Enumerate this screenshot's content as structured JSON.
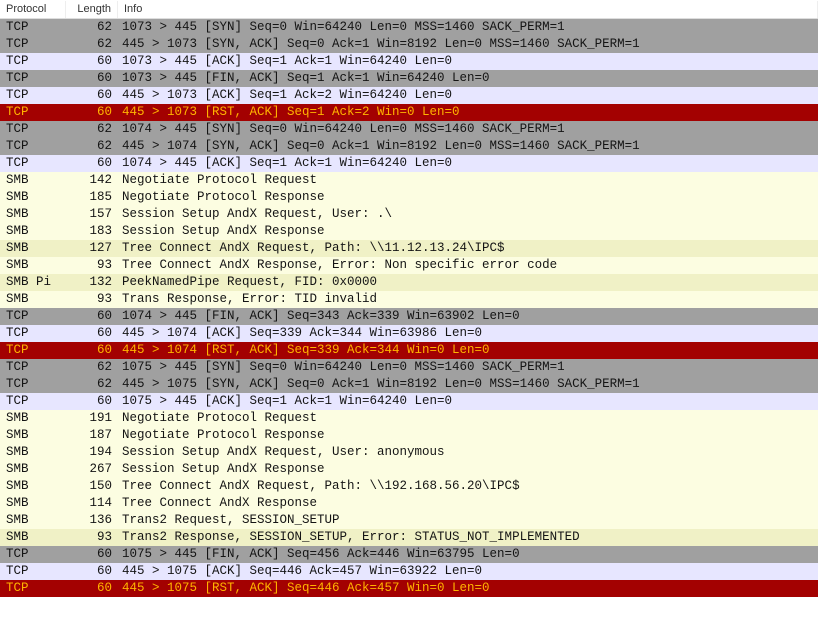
{
  "headers": {
    "protocol": "Protocol",
    "length": "Length",
    "info": "Info"
  },
  "rows": [
    {
      "cls": "c-gray",
      "proto": "TCP",
      "len": 62,
      "info": "1073 > 445 [SYN] Seq=0 Win=64240 Len=0 MSS=1460 SACK_PERM=1"
    },
    {
      "cls": "c-gray",
      "proto": "TCP",
      "len": 62,
      "info": "445 > 1073 [SYN, ACK] Seq=0 Ack=1 Win=8192 Len=0 MSS=1460 SACK_PERM=1"
    },
    {
      "cls": "c-lav",
      "proto": "TCP",
      "len": 60,
      "info": "1073 > 445 [ACK] Seq=1 Ack=1 Win=64240 Len=0"
    },
    {
      "cls": "c-gray",
      "proto": "TCP",
      "len": 60,
      "info": "1073 > 445 [FIN, ACK] Seq=1 Ack=1 Win=64240 Len=0"
    },
    {
      "cls": "c-lav",
      "proto": "TCP",
      "len": 60,
      "info": "445 > 1073 [ACK] Seq=1 Ack=2 Win=64240 Len=0"
    },
    {
      "cls": "c-red",
      "proto": "TCP",
      "len": 60,
      "info": "445 > 1073 [RST, ACK] Seq=1 Ack=2 Win=0 Len=0"
    },
    {
      "cls": "c-gray",
      "proto": "TCP",
      "len": 62,
      "info": "1074 > 445 [SYN] Seq=0 Win=64240 Len=0 MSS=1460 SACK_PERM=1"
    },
    {
      "cls": "c-gray",
      "proto": "TCP",
      "len": 62,
      "info": "445 > 1074 [SYN, ACK] Seq=0 Ack=1 Win=8192 Len=0 MSS=1460 SACK_PERM=1"
    },
    {
      "cls": "c-lav",
      "proto": "TCP",
      "len": 60,
      "info": "1074 > 445 [ACK] Seq=1 Ack=1 Win=64240 Len=0"
    },
    {
      "cls": "c-yel-l",
      "proto": "SMB",
      "len": 142,
      "info": "Negotiate Protocol Request"
    },
    {
      "cls": "c-yel-l",
      "proto": "SMB",
      "len": 185,
      "info": "Negotiate Protocol Response"
    },
    {
      "cls": "c-yel-l",
      "proto": "SMB",
      "len": 157,
      "info": "Session Setup AndX Request, User: .\\"
    },
    {
      "cls": "c-yel-l",
      "proto": "SMB",
      "len": 183,
      "info": "Session Setup AndX Response"
    },
    {
      "cls": "c-yel-d",
      "proto": "SMB",
      "len": 127,
      "info": "Tree Connect AndX Request, Path: \\\\11.12.13.24\\IPC$"
    },
    {
      "cls": "c-yel-l",
      "proto": "SMB",
      "len": 93,
      "info": "Tree Connect AndX Response, Error: Non specific error code"
    },
    {
      "cls": "c-yel-d",
      "proto": "SMB Pi",
      "len": 132,
      "info": "PeekNamedPipe Request, FID: 0x0000"
    },
    {
      "cls": "c-yel-l",
      "proto": "SMB",
      "len": 93,
      "info": "Trans Response, Error: TID invalid"
    },
    {
      "cls": "c-gray",
      "proto": "TCP",
      "len": 60,
      "info": "1074 > 445 [FIN, ACK] Seq=343 Ack=339 Win=63902 Len=0"
    },
    {
      "cls": "c-lav",
      "proto": "TCP",
      "len": 60,
      "info": "445 > 1074 [ACK] Seq=339 Ack=344 Win=63986 Len=0"
    },
    {
      "cls": "c-red",
      "proto": "TCP",
      "len": 60,
      "info": "445 > 1074 [RST, ACK] Seq=339 Ack=344 Win=0 Len=0"
    },
    {
      "cls": "c-gray",
      "proto": "TCP",
      "len": 62,
      "info": "1075 > 445 [SYN] Seq=0 Win=64240 Len=0 MSS=1460 SACK_PERM=1"
    },
    {
      "cls": "c-gray",
      "proto": "TCP",
      "len": 62,
      "info": "445 > 1075 [SYN, ACK] Seq=0 Ack=1 Win=8192 Len=0 MSS=1460 SACK_PERM=1"
    },
    {
      "cls": "c-lav",
      "proto": "TCP",
      "len": 60,
      "info": "1075 > 445 [ACK] Seq=1 Ack=1 Win=64240 Len=0"
    },
    {
      "cls": "c-yel-l",
      "proto": "SMB",
      "len": 191,
      "info": "Negotiate Protocol Request"
    },
    {
      "cls": "c-yel-l",
      "proto": "SMB",
      "len": 187,
      "info": "Negotiate Protocol Response"
    },
    {
      "cls": "c-yel-l",
      "proto": "SMB",
      "len": 194,
      "info": "Session Setup AndX Request, User: anonymous"
    },
    {
      "cls": "c-yel-l",
      "proto": "SMB",
      "len": 267,
      "info": "Session Setup AndX Response"
    },
    {
      "cls": "c-yel-l",
      "proto": "SMB",
      "len": 150,
      "info": "Tree Connect AndX Request, Path: \\\\192.168.56.20\\IPC$"
    },
    {
      "cls": "c-yel-l",
      "proto": "SMB",
      "len": 114,
      "info": "Tree Connect AndX Response"
    },
    {
      "cls": "c-yel-l",
      "proto": "SMB",
      "len": 136,
      "info": "Trans2 Request, SESSION_SETUP"
    },
    {
      "cls": "c-yel-d",
      "proto": "SMB",
      "len": 93,
      "info": "Trans2 Response, SESSION_SETUP, Error: STATUS_NOT_IMPLEMENTED"
    },
    {
      "cls": "c-gray",
      "proto": "TCP",
      "len": 60,
      "info": "1075 > 445 [FIN, ACK] Seq=456 Ack=446 Win=63795 Len=0"
    },
    {
      "cls": "c-lav",
      "proto": "TCP",
      "len": 60,
      "info": "445 > 1075 [ACK] Seq=446 Ack=457 Win=63922 Len=0"
    },
    {
      "cls": "c-red",
      "proto": "TCP",
      "len": 60,
      "info": "445 > 1075 [RST, ACK] Seq=446 Ack=457 Win=0 Len=0"
    }
  ]
}
